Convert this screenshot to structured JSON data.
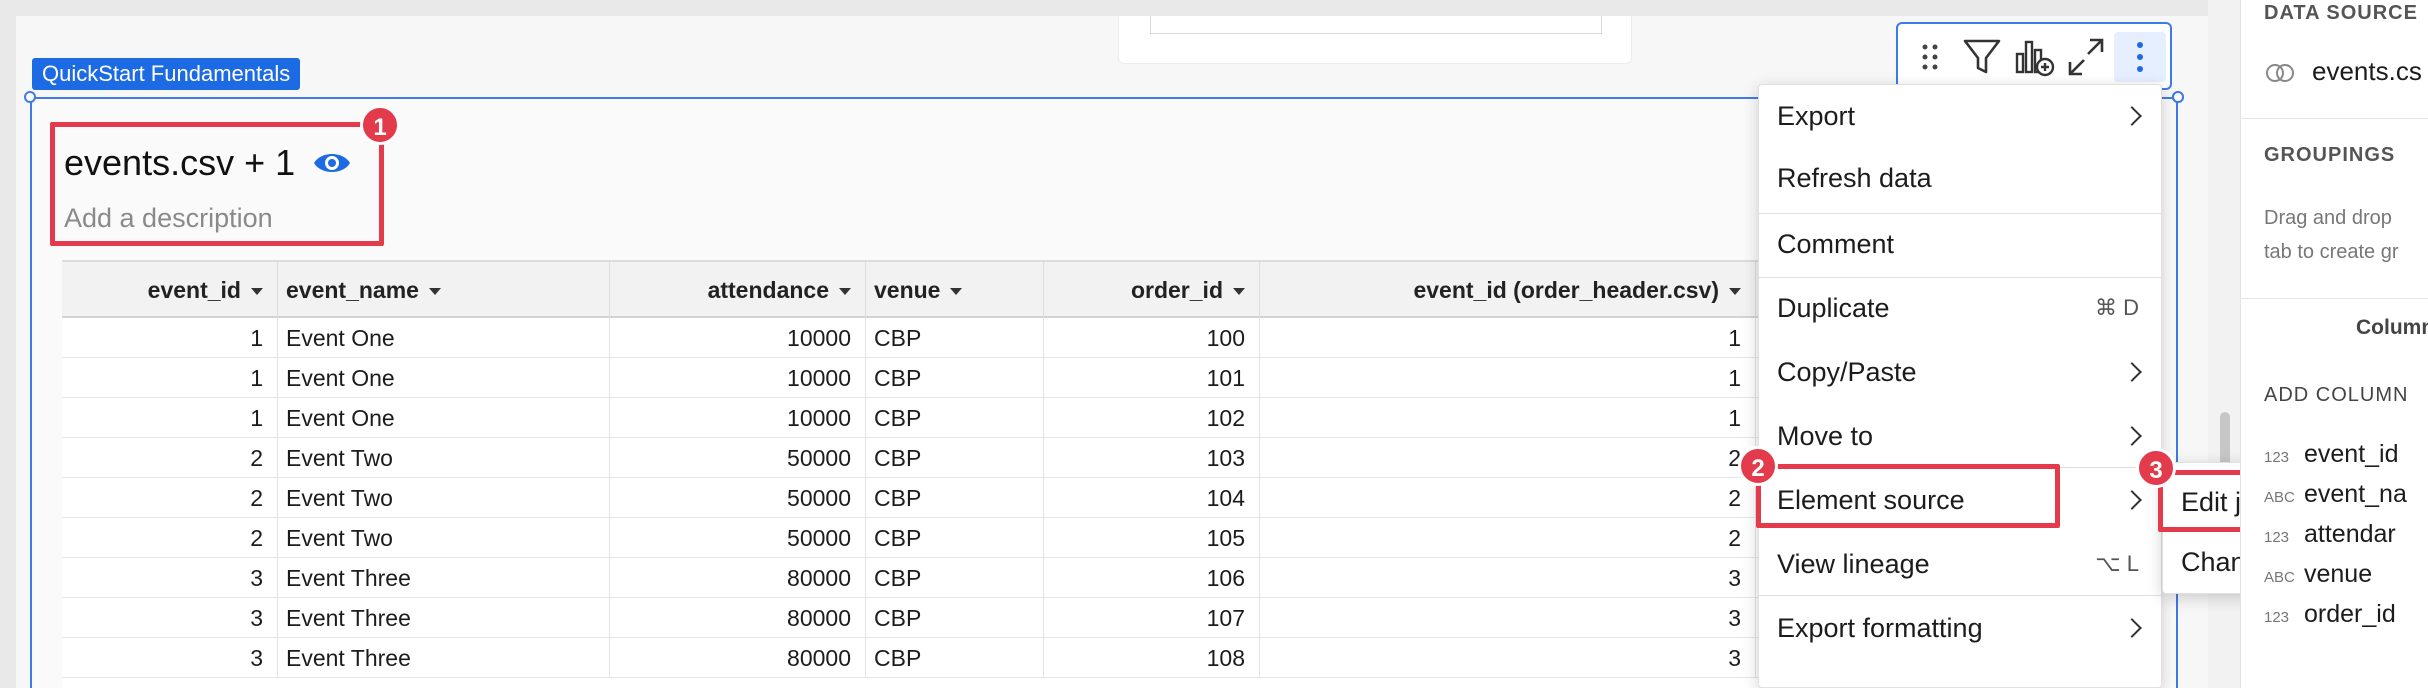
{
  "element_tag": "QuickStart Fundamentals",
  "element": {
    "title": "events.csv + 1",
    "description": "Add a description"
  },
  "callouts": [
    "1",
    "2",
    "3"
  ],
  "table": {
    "columns": [
      "event_id",
      "event_name",
      "attendance",
      "venue",
      "order_id",
      "event_id (order_header.csv)"
    ],
    "rows": [
      [
        "1",
        "Event One",
        "10000",
        "CBP",
        "100",
        "1"
      ],
      [
        "1",
        "Event One",
        "10000",
        "CBP",
        "101",
        "1"
      ],
      [
        "1",
        "Event One",
        "10000",
        "CBP",
        "102",
        "1"
      ],
      [
        "2",
        "Event Two",
        "50000",
        "CBP",
        "103",
        "2"
      ],
      [
        "2",
        "Event Two",
        "50000",
        "CBP",
        "104",
        "2"
      ],
      [
        "2",
        "Event Two",
        "50000",
        "CBP",
        "105",
        "2"
      ],
      [
        "3",
        "Event Three",
        "80000",
        "CBP",
        "106",
        "3"
      ],
      [
        "3",
        "Event Three",
        "80000",
        "CBP",
        "107",
        "3"
      ],
      [
        "3",
        "Event Three",
        "80000",
        "CBP",
        "108",
        "3"
      ]
    ]
  },
  "toolbar": {
    "icons": [
      "drag-handle-icon",
      "filter-icon",
      "add-chart-icon",
      "expand-icon",
      "more-vertical-icon"
    ]
  },
  "menu": {
    "items": [
      {
        "label": "Export",
        "submenu": true
      },
      {
        "label": "Refresh data"
      },
      {
        "label": "Comment"
      },
      {
        "label": "Duplicate",
        "shortcut": "⌘ D"
      },
      {
        "label": "Copy/Paste",
        "submenu": true
      },
      {
        "label": "Move to",
        "submenu": true
      },
      {
        "label": "Element source",
        "submenu": true
      },
      {
        "label": "View lineage",
        "shortcut": "⌥ L"
      },
      {
        "label": "Export formatting",
        "submenu": true
      }
    ]
  },
  "submenu": {
    "items": [
      "Edit join...",
      "Change source..."
    ]
  },
  "right_panel": {
    "data_source_label": "DATA SOURCE",
    "data_source_value": "events.cs",
    "groupings_label": "GROUPINGS",
    "groupings_hint_1": "Drag and drop",
    "groupings_hint_2": "tab to create gr",
    "columns_label": "Columns",
    "add_column_label": "ADD COLUMN",
    "fields": [
      {
        "type": "123",
        "name": "event_id"
      },
      {
        "type": "ABC",
        "name": "event_na"
      },
      {
        "type": "123",
        "name": "attendar"
      },
      {
        "type": "ABC",
        "name": "venue"
      },
      {
        "type": "123",
        "name": "order_id"
      }
    ]
  },
  "colors": {
    "accent": "#3e7be8",
    "tag": "#1d6ae5",
    "callout": "#e33b4b",
    "eye": "#1d6ae5"
  }
}
